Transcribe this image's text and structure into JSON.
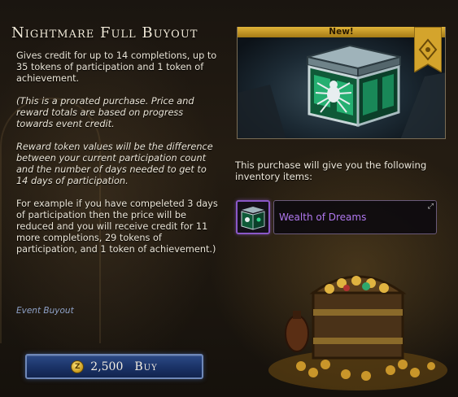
{
  "offer": {
    "title": "Nightmare Full Buyout",
    "description": [
      "Gives credit for up to 14 completions, up to 35 tokens of participation and 1 token of achievement.",
      "(This is a prorated purchase. Price and reward totals are based on progress towards event credit.",
      "Reward token values will be the difference between your current participation count and the number of days needed to get to 14 days of participation.",
      "For example if you have compeleted 3 days of participation then the price will be reduced and you will receive credit for 11 more completions, 29 tokens of participation, and 1 token of achievement.)"
    ],
    "category": "Event Buyout"
  },
  "buy": {
    "currency_icon": "zen-coin-icon",
    "price": "2,500",
    "label": "Buy"
  },
  "preview": {
    "badge": "New!"
  },
  "rewards": {
    "intro": "This purchase will give you the following inventory items:",
    "items": [
      {
        "name": "Wealth of Dreams",
        "icon": "spider-chest-icon",
        "rarity_color": "#b078ef"
      }
    ]
  },
  "colors": {
    "title": "#f2ead8",
    "accent_gold": "#d4a42c",
    "button_blue": "#1a3266",
    "link": "#8fa2c8"
  }
}
